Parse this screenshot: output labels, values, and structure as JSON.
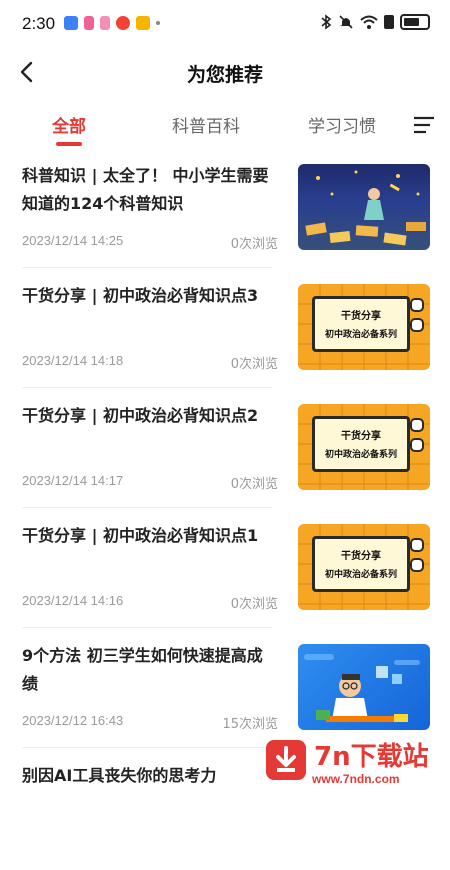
{
  "status": {
    "time": "2:30"
  },
  "header": {
    "title": "为您推荐"
  },
  "tabs": [
    {
      "label": "全部",
      "active": true
    },
    {
      "label": "科普百科"
    },
    {
      "label": "学习习惯"
    }
  ],
  "articles": [
    {
      "title": "科普知识 | 太全了！ 中小学生需要知道的124个科普知识",
      "date": "2023/12/14 14:25",
      "views": "0次浏览",
      "thumb": "night-illustration"
    },
    {
      "title": "干货分享 | 初中政治必背知识点3",
      "date": "2023/12/14 14:18",
      "views": "0次浏览",
      "thumb": "tv",
      "thumb_text1": "干货分享",
      "thumb_text2": "初中政治必备系列"
    },
    {
      "title": "干货分享 | 初中政治必背知识点2",
      "date": "2023/12/14 14:17",
      "views": "0次浏览",
      "thumb": "tv",
      "thumb_text1": "干货分享",
      "thumb_text2": "初中政治必备系列"
    },
    {
      "title": "干货分享 | 初中政治必背知识点1",
      "date": "2023/12/14 14:16",
      "views": "0次浏览",
      "thumb": "tv",
      "thumb_text1": "干货分享",
      "thumb_text2": "初中政治必备系列"
    },
    {
      "title": "9个方法 初三学生如何快速提高成绩",
      "date": "2023/12/12 16:43",
      "views": "15次浏览",
      "thumb": "blue-illustration"
    },
    {
      "title": "别因AI工具丧失你的思考力",
      "date": "",
      "views": "",
      "thumb": ""
    }
  ],
  "watermark": {
    "name": "7n下载站",
    "url": "www.7ndn.com"
  },
  "colors": {
    "accent": "#e53935",
    "tv_orange": "#f6a623"
  }
}
